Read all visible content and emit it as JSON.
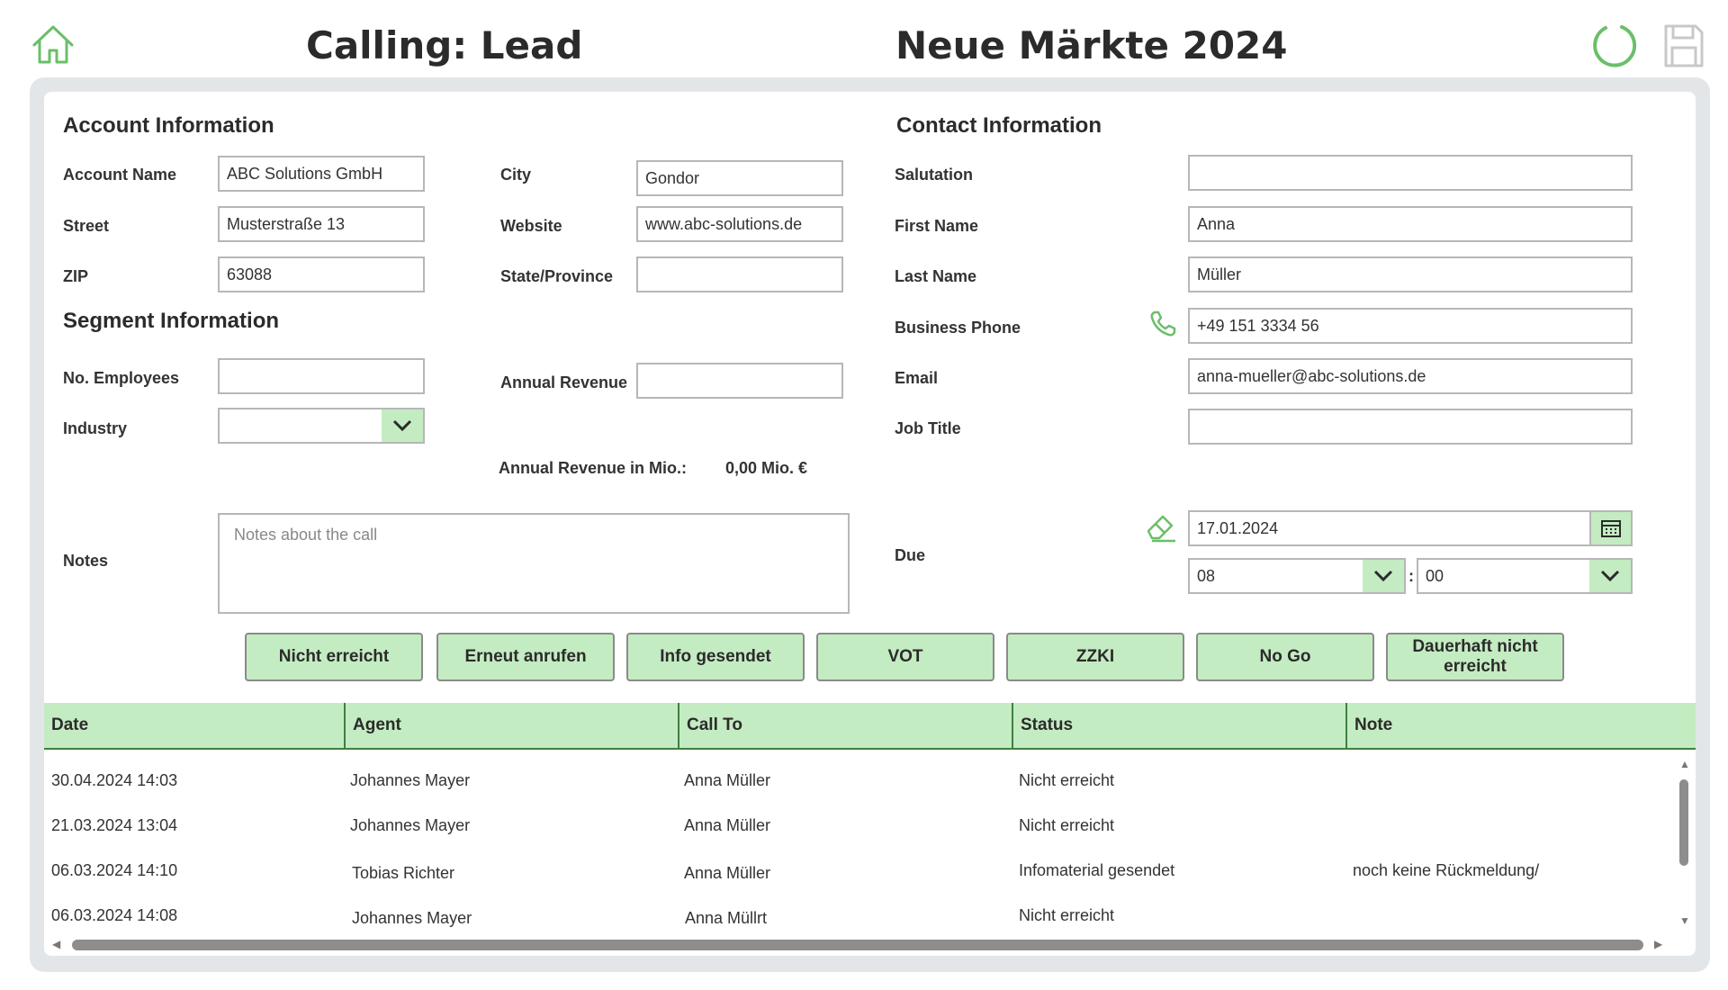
{
  "header": {
    "title_left": "Calling: Lead",
    "title_right": "Neue Märkte 2024",
    "icons": [
      "home-icon",
      "refresh-icon",
      "save-icon"
    ]
  },
  "colors": {
    "accent_green": "#6abf69",
    "button_green": "#c4ecc2",
    "header_line": "#3f7f3f"
  },
  "account": {
    "title": "Account Information",
    "account_name_label": "Account Name",
    "account_name": "ABC Solutions GmbH",
    "street_label": "Street",
    "street": "Musterstraße 13",
    "zip_label": "ZIP",
    "zip": "63088",
    "city_label": "City",
    "city": "Gondor",
    "website_label": "Website",
    "website": "www.abc-solutions.de",
    "state_label": "State/Province",
    "state": ""
  },
  "segment": {
    "title": "Segment Information",
    "employees_label": "No. Employees",
    "employees": "",
    "industry_label": "Industry",
    "industry": "",
    "revenue_label": "Annual Revenue",
    "revenue": "",
    "revenue_mio_label": "Annual Revenue in Mio.:",
    "revenue_mio_value": "0,00 Mio. €"
  },
  "notes": {
    "label": "Notes",
    "placeholder": "Notes about the call"
  },
  "contact": {
    "title": "Contact Information",
    "salutation_label": "Salutation",
    "salutation": "",
    "first_name_label": "First Name",
    "first_name": "Anna",
    "last_name_label": "Last Name",
    "last_name": "Müller",
    "phone_label": "Business Phone",
    "phone": "+49 151 3334 56",
    "email_label": "Email",
    "email": "anna-mueller@abc-solutions.de",
    "job_title_label": "Job Title",
    "job_title": ""
  },
  "due": {
    "label": "Due",
    "date": "17.01.2024",
    "hour": "08",
    "minute": "00",
    "separator": ":"
  },
  "buttons": [
    {
      "label": "Nicht erreicht"
    },
    {
      "label": "Erneut anrufen"
    },
    {
      "label": "Info gesendet"
    },
    {
      "label": "VOT"
    },
    {
      "label": "ZZKI"
    },
    {
      "label": "No Go"
    },
    {
      "label": "Dauerhaft nicht erreicht"
    }
  ],
  "table": {
    "columns": [
      "Date",
      "Agent",
      "Call To",
      "Status",
      "Note"
    ],
    "rows": [
      [
        "30.04.2024 14:03",
        "Johannes Mayer",
        "Anna Müller",
        "Nicht erreicht",
        ""
      ],
      [
        "21.03.2024 13:04",
        "Johannes Mayer",
        "Anna Müller",
        "Nicht erreicht",
        ""
      ],
      [
        "06.03.2024 14:10",
        "Tobias Richter",
        "Anna Müller",
        "Infomaterial gesendet",
        "noch keine Rückmeldung/"
      ],
      [
        "06.03.2024 14:08",
        "Johannes Mayer",
        "Anna Müllrt",
        "Nicht erreicht",
        ""
      ]
    ]
  }
}
